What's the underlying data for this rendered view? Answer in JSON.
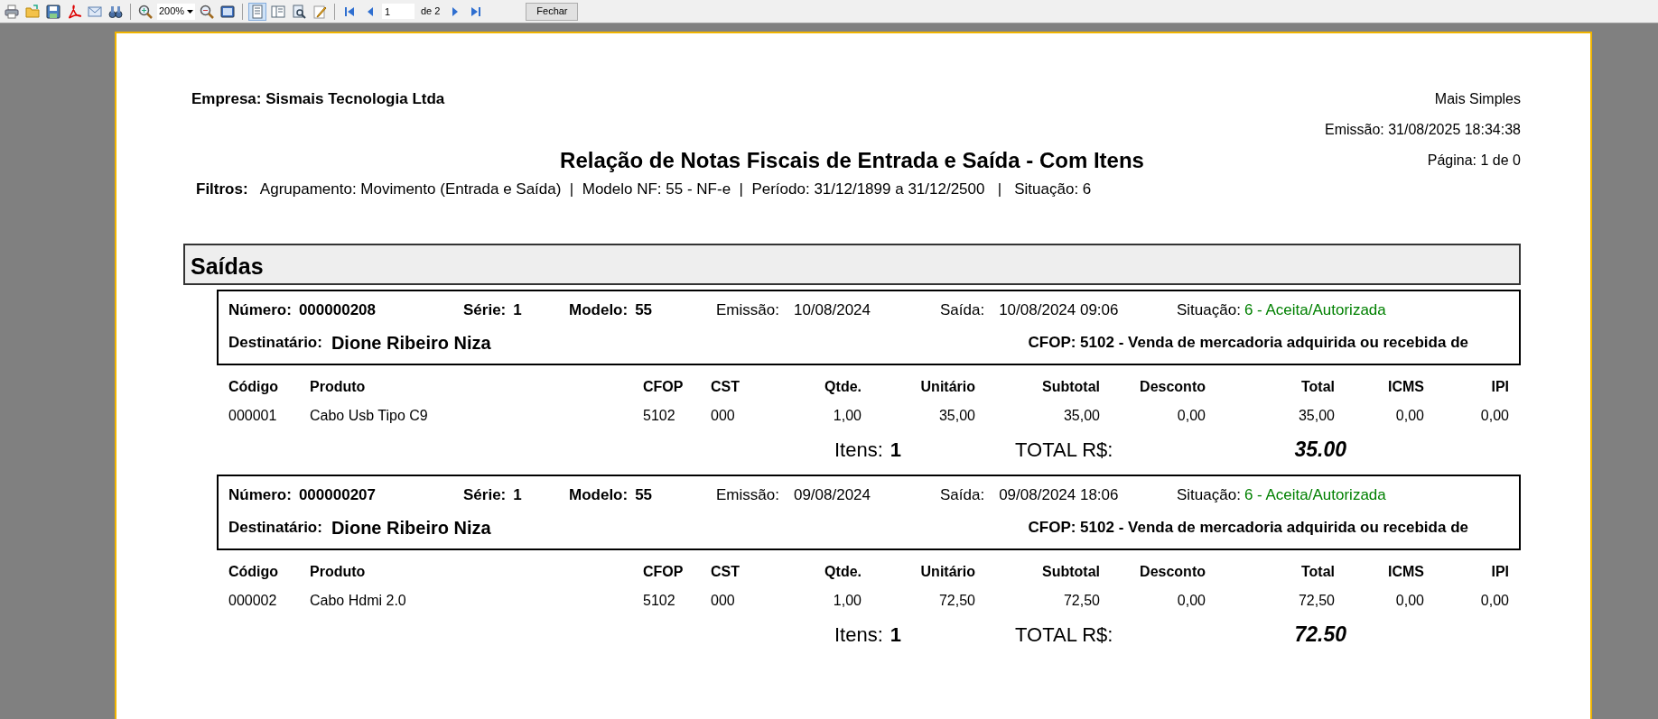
{
  "toolbar": {
    "zoom": "200%",
    "page": "1",
    "page_total": "de 2",
    "close": "Fechar",
    "view_toggles": [
      {
        "selected": true
      },
      {
        "selected": false
      },
      {
        "selected": false
      },
      {
        "selected": false
      }
    ]
  },
  "report": {
    "company": "Empresa: Sismais Tecnologia Ltda",
    "brand": "Mais Simples",
    "emission": "Emissão: 31/08/2025 18:34:38",
    "page": "Página: 1 de 0",
    "title": "Relação de Notas Fiscais de Entrada e Saída - Com Itens",
    "filters_label": "Filtros:",
    "filters": "Agrupamento: Movimento (Entrada e Saída)  |  Modelo NF: 55 - NF-e  |  Período: 31/12/1899 a 31/12/2500   |   Situação: 6"
  },
  "section": "Saídas",
  "invoices": [
    {
      "fields": [
        {
          "label": "Número:",
          "value": "000000208",
          "kind": "bold"
        },
        {
          "label": "Série:",
          "value": "1",
          "kind": "bold"
        },
        {
          "label": "Modelo:",
          "value": "55",
          "kind": "bold"
        },
        {
          "label": "Emissão:",
          "value": "10/08/2024",
          "kind": "plain"
        },
        {
          "label": "Saída:",
          "value": "10/08/2024 09:06",
          "kind": "plain"
        },
        {
          "label": "Situação:",
          "value": "6 - Aceita/Autorizada",
          "kind": "status"
        }
      ],
      "recipient_label": "Destinatário:",
      "recipient": "Dione Ribeiro Niza",
      "cfop": "CFOP: 5102 - Venda de mercadoria adquirida ou recebida de",
      "columns": [
        "Código",
        "Produto",
        "CFOP",
        "CST",
        "Qtde.",
        "Unitário",
        "Subtotal",
        "Desconto",
        "Total",
        "ICMS",
        "IPI"
      ],
      "items": [
        [
          "000001",
          "Cabo Usb Tipo C9",
          "5102",
          "000",
          "1,00",
          "35,00",
          "35,00",
          "0,00",
          "35,00",
          "0,00",
          "0,00"
        ]
      ],
      "items_label": "Itens:",
      "items_count": "1",
      "total_label": "TOTAL R$:",
      "total": "35.00"
    },
    {
      "fields": [
        {
          "label": "Número:",
          "value": "000000207",
          "kind": "bold"
        },
        {
          "label": "Série:",
          "value": "1",
          "kind": "bold"
        },
        {
          "label": "Modelo:",
          "value": "55",
          "kind": "bold"
        },
        {
          "label": "Emissão:",
          "value": "09/08/2024",
          "kind": "plain"
        },
        {
          "label": "Saída:",
          "value": "09/08/2024 18:06",
          "kind": "plain"
        },
        {
          "label": "Situação:",
          "value": "6 - Aceita/Autorizada",
          "kind": "status"
        }
      ],
      "recipient_label": "Destinatário:",
      "recipient": "Dione Ribeiro Niza",
      "cfop": "CFOP: 5102 - Venda de mercadoria adquirida ou recebida de",
      "columns": [
        "Código",
        "Produto",
        "CFOP",
        "CST",
        "Qtde.",
        "Unitário",
        "Subtotal",
        "Desconto",
        "Total",
        "ICMS",
        "IPI"
      ],
      "items": [
        [
          "000002",
          "Cabo Hdmi 2.0",
          "5102",
          "000",
          "1,00",
          "72,50",
          "72,50",
          "0,00",
          "72,50",
          "0,00",
          "0,00"
        ]
      ],
      "items_label": "Itens:",
      "items_count": "1",
      "total_label": "TOTAL R$:",
      "total": "72.50"
    }
  ]
}
